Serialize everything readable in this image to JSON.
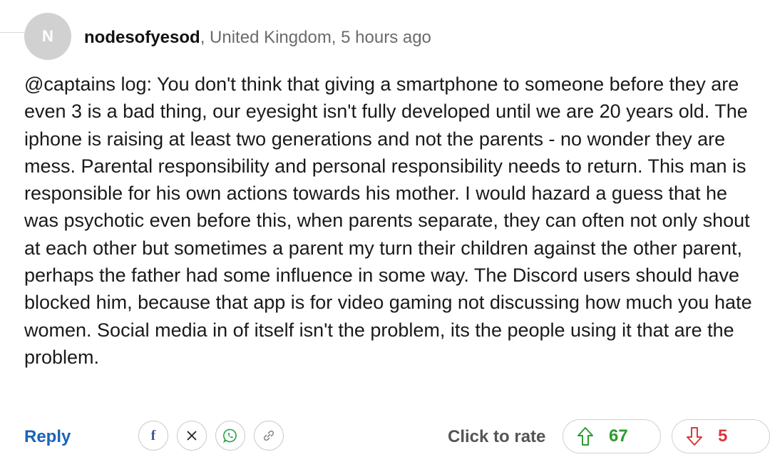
{
  "comment": {
    "avatar_initial": "N",
    "username": "nodesofyesod",
    "location": ", United Kingdom, ",
    "timestamp": "5 hours ago",
    "body": "@captains log: You don't think that giving a smartphone to someone before they are even 3 is a bad thing, our eyesight isn't fully developed until we are 20 years old. The iphone is raising at least two generations and not the parents - no wonder they are mess. Parental responsibility and personal responsibility needs to return. This man is responsible for his own actions towards his mother. I would hazard a guess that he was psychotic even before this, when parents separate, they can often not only shout at each other but sometimes a parent my turn their children against the other parent, perhaps the father had some influence in some way. The Discord users should have blocked him, because that app is for video gaming not discussing how much you hate women. Social media in of itself isn't the problem, its the people using it that are the problem."
  },
  "footer": {
    "reply_label": "Reply",
    "share_icons": [
      "facebook-icon",
      "x-icon",
      "whatsapp-icon",
      "link-icon"
    ],
    "rate_label": "Click to rate",
    "upvotes": "67",
    "downvotes": "5"
  },
  "colors": {
    "reply": "#1a64b8",
    "upvote": "#2e9a2e",
    "downvote": "#d63a3a"
  }
}
